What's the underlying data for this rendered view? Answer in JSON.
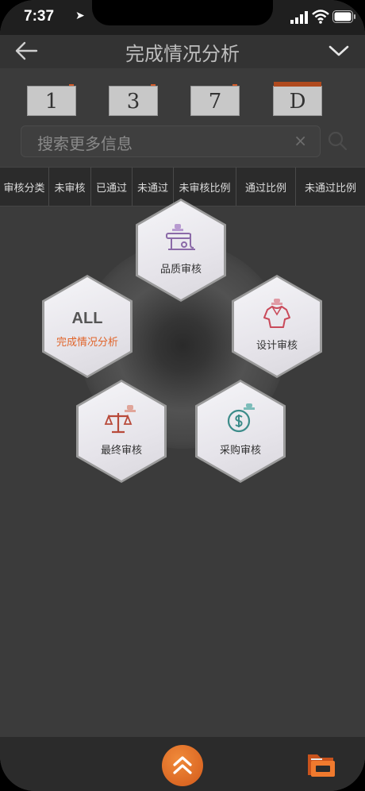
{
  "status": {
    "time": "7:37"
  },
  "header": {
    "title": "完成情况分析"
  },
  "counters": [
    {
      "label": "1"
    },
    {
      "label": "3"
    },
    {
      "label": "7"
    },
    {
      "label": "D"
    }
  ],
  "search": {
    "placeholder": "搜索更多信息",
    "clear_glyph": "×"
  },
  "tabs": [
    "审核分类",
    "未审核",
    "已通过",
    "未通过",
    "未审核比例",
    "通过比例",
    "未通过比例"
  ],
  "hexes": {
    "quality": {
      "label": "品质审核",
      "icon": "sewing-machine-stamp-icon"
    },
    "all": {
      "title": "ALL",
      "subtitle": "完成情况分析"
    },
    "design": {
      "label": "设计审核",
      "icon": "garment-stamp-icon"
    },
    "final": {
      "label": "最终审核",
      "icon": "scale-stamp-icon"
    },
    "purchase": {
      "label": "采购审核",
      "icon": "dollar-shield-stamp-icon"
    }
  },
  "colors": {
    "accent": "#e0642a",
    "background": "#3b3b3b"
  }
}
